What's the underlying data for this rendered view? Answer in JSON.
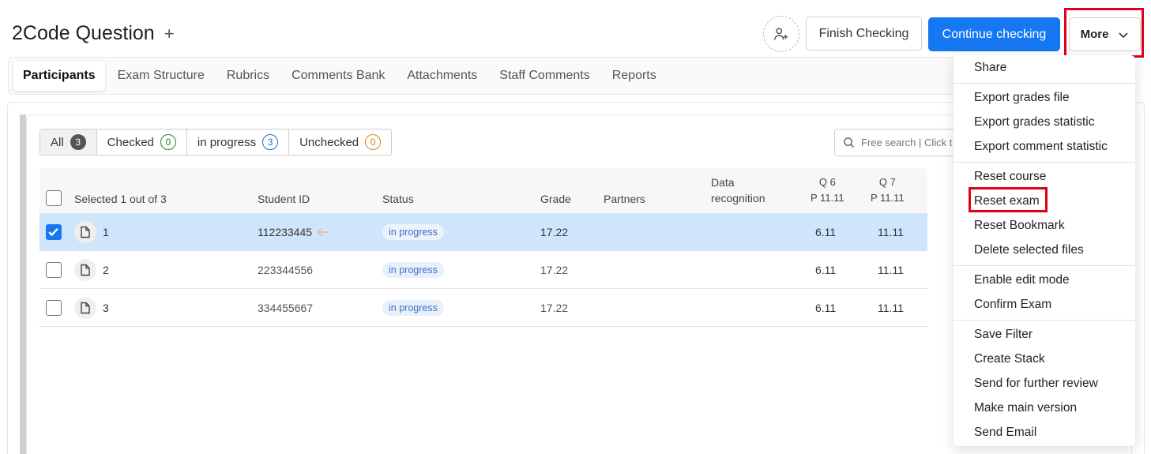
{
  "header": {
    "title": "2Code Question",
    "plus": "+",
    "finish_label": "Finish Checking",
    "continue_label": "Continue checking",
    "more_label": "More"
  },
  "tabs": [
    "Participants",
    "Exam Structure",
    "Rubrics",
    "Comments Bank",
    "Attachments",
    "Staff Comments",
    "Reports"
  ],
  "filters": {
    "all": {
      "label": "All",
      "count": "3"
    },
    "checked": {
      "label": "Checked",
      "count": "0"
    },
    "in_progress": {
      "label": "in progress",
      "count": "3"
    },
    "unchecked": {
      "label": "Unchecked",
      "count": "0"
    }
  },
  "search": {
    "placeholder": "Free search | Click t"
  },
  "table": {
    "selected_text": "Selected 1 out of 3",
    "columns": {
      "student_id": "Student ID",
      "status": "Status",
      "grade": "Grade",
      "partners": "Partners",
      "data_recognition_1": "Data",
      "data_recognition_2": "recognition",
      "q6_1": "Q 6",
      "q6_2": "P 11.11",
      "q7_1": "Q 7",
      "q7_2": "P 11.11"
    },
    "rows": [
      {
        "num": "1",
        "student_id": "112233445",
        "status": "in progress",
        "grade": "17.22",
        "q6": "6.11",
        "q7": "11.11"
      },
      {
        "num": "2",
        "student_id": "223344556",
        "status": "in progress",
        "grade": "17.22",
        "q6": "6.11",
        "q7": "11.11"
      },
      {
        "num": "3",
        "student_id": "334455667",
        "status": "in progress",
        "grade": "17.22",
        "q6": "6.11",
        "q7": "11.11"
      }
    ]
  },
  "menu": {
    "share": "Share",
    "export_grades_file": "Export grades file",
    "export_grades_statistic": "Export grades statistic",
    "export_comment_statistic": "Export comment statistic",
    "reset_course": "Reset course",
    "reset_exam": "Reset exam",
    "reset_bookmark": "Reset Bookmark",
    "delete_selected_files": "Delete selected files",
    "enable_edit_mode": "Enable edit mode",
    "confirm_exam": "Confirm Exam",
    "save_filter": "Save Filter",
    "create_stack": "Create Stack",
    "send_for_further_review": "Send for further review",
    "make_main_version": "Make main version",
    "send_email": "Send Email"
  },
  "colors": {
    "primary": "#1677f2",
    "highlight": "#e0001b",
    "selected_row": "#cfe5fb"
  }
}
